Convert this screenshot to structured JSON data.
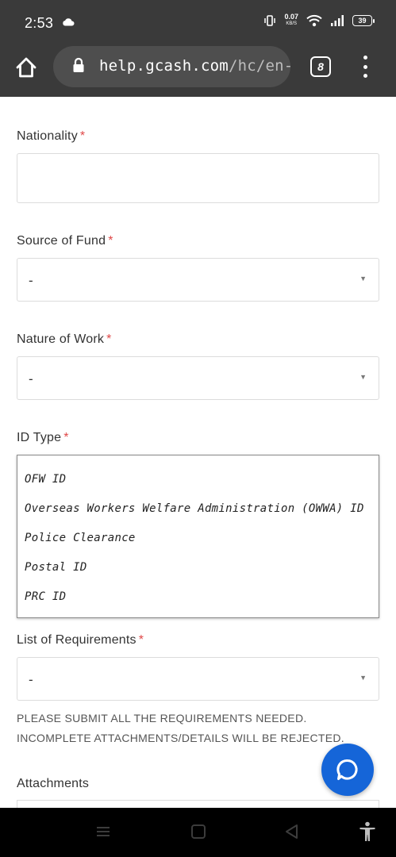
{
  "status_bar": {
    "time": "2:53",
    "net_speed_value": "0.07",
    "net_speed_unit": "KB/S",
    "battery": "39"
  },
  "browser": {
    "url_host": "help.gcash.com",
    "url_path": "/hc/en-",
    "tab_count": "8"
  },
  "form": {
    "nationality": {
      "label": "Nationality",
      "required_mark": "*",
      "value": ""
    },
    "source_of_fund": {
      "label": "Source of Fund",
      "required_mark": "*",
      "value": "-"
    },
    "nature_of_work": {
      "label": "Nature of Work",
      "required_mark": "*",
      "value": "-"
    },
    "id_type": {
      "label": "ID Type",
      "required_mark": "*",
      "options": [
        "OFW ID",
        "Overseas Workers Welfare Administration (OWWA) ID",
        "Police Clearance",
        "Postal ID",
        "PRC ID"
      ]
    },
    "list_of_requirements": {
      "label": "List of Requirements",
      "required_mark": "*",
      "value": "-"
    },
    "notice": "PLEASE SUBMIT ALL THE REQUIREMENTS NEEDED. INCOMPLETE ATTACHMENTS/DETAILS WILL BE REJECTED.",
    "attachments": {
      "label": "Attachments"
    }
  },
  "colors": {
    "bar_background": "#3a3a3a",
    "required": "#e04848",
    "chat_button": "#1565d8"
  },
  "icons": [
    "cloud-icon",
    "vibrate-icon",
    "wifi-icon",
    "signal-icon",
    "battery-icon",
    "home-icon",
    "lock-icon",
    "more-vert-icon",
    "chat-icon",
    "menu-icon",
    "square-icon",
    "back-icon",
    "accessibility-icon"
  ]
}
